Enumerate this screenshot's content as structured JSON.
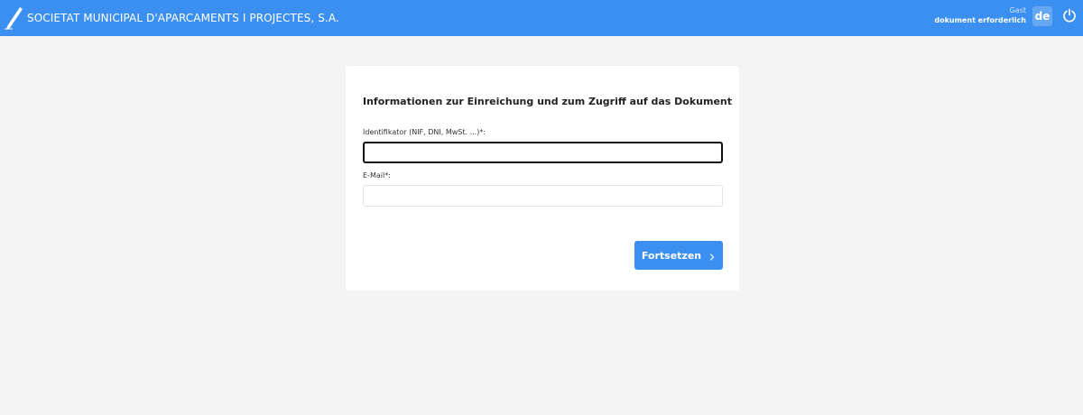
{
  "header": {
    "company_name": "SOCIETAT MUNICIPAL D'APARCAMENTS I PROJECTES, S.A.",
    "logo_icon": "pen-icon",
    "user_role": "Gast",
    "user_status": "dokument erforderlich",
    "language": "de",
    "power_icon": "power-icon"
  },
  "form": {
    "title": "Informationen zur Einreichung und zum Zugriff auf das Dokument",
    "identifier": {
      "label": "Identifikator (NIF, DNI, MwSt. ...)*:",
      "value": "",
      "placeholder": ""
    },
    "email": {
      "label": "E-Mail*:",
      "value": "",
      "placeholder": ""
    },
    "continue_label": "Fortsetzen",
    "continue_icon": "chevron-right-icon"
  },
  "colors": {
    "primary": "#3b8ff0",
    "background": "#f4f4f4",
    "card": "#ffffff"
  }
}
